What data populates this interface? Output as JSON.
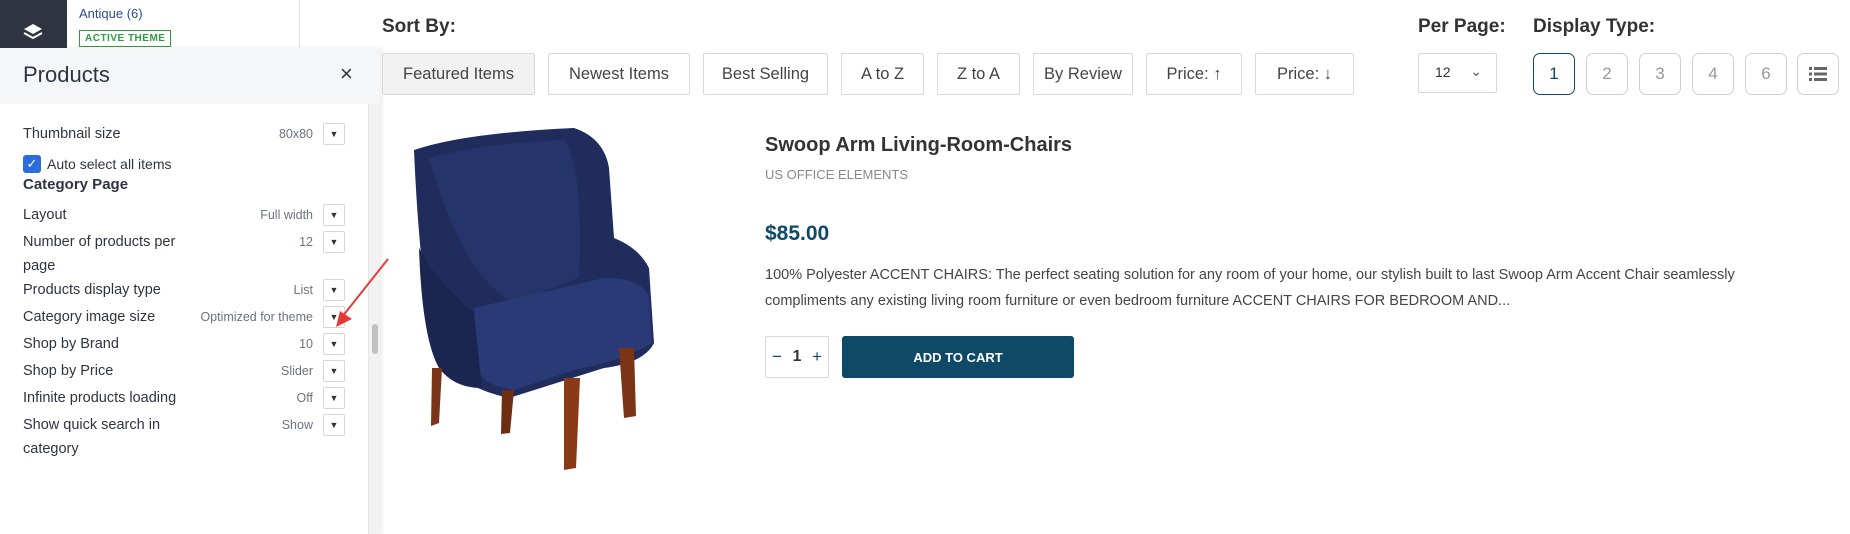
{
  "theme": {
    "name": "Antique (6)",
    "badge": "ACTIVE THEME"
  },
  "panel": {
    "title": "Products",
    "close": "×",
    "auto_select": {
      "label": "Auto select all items",
      "checked": true
    },
    "thumbnail": {
      "label": "Thumbnail size",
      "value": "80x80"
    },
    "category_section": "Category Page",
    "rows": [
      {
        "label": "Layout",
        "value": "Full width"
      },
      {
        "label": "Number of products per page",
        "value": "12"
      },
      {
        "label": "Products display type",
        "value": "List"
      },
      {
        "label": "Category image size",
        "value": "Optimized for theme"
      },
      {
        "label": "Shop by Brand",
        "value": "10"
      },
      {
        "label": "Shop by Price",
        "value": "Slider"
      },
      {
        "label": "Infinite products loading",
        "value": "Off"
      },
      {
        "label": "Show quick search in category",
        "value": "Show"
      }
    ]
  },
  "sort": {
    "label": "Sort By:",
    "options": [
      "Featured Items",
      "Newest Items",
      "Best Selling",
      "A to Z",
      "Z to A",
      "By Review",
      "Price: ↑",
      "Price: ↓"
    ],
    "active": "Featured Items"
  },
  "per_page": {
    "label": "Per Page:",
    "value": "12"
  },
  "display_type": {
    "label": "Display Type:",
    "options": [
      "1",
      "2",
      "3",
      "4",
      "6"
    ],
    "active": "1"
  },
  "product": {
    "name": "Swoop Arm Living-Room-Chairs",
    "brand": "US OFFICE ELEMENTS",
    "price": "$85.00",
    "description": "100% Polyester ACCENT CHAIRS: The perfect seating solution for any room of your home, our stylish built to last Swoop Arm Accent Chair seamlessly compliments any existing living room furniture or even bedroom furniture ACCENT CHAIRS FOR BEDROOM AND...",
    "quantity": "1",
    "add_to_cart": "ADD TO CART",
    "minus": "−",
    "plus": "+"
  },
  "colors": {
    "accent": "#0e4a67",
    "badge_green": "#2e9c43",
    "checkbox_blue": "#2d6cdf",
    "rail": "#2f3540",
    "arrow_red": "#e53935"
  },
  "icons": [
    "layers-icon",
    "close-icon",
    "check-icon",
    "dropdown-caret-icon",
    "chevron-down-icon",
    "list-view-icon",
    "arrow-up-icon",
    "arrow-down-icon"
  ]
}
